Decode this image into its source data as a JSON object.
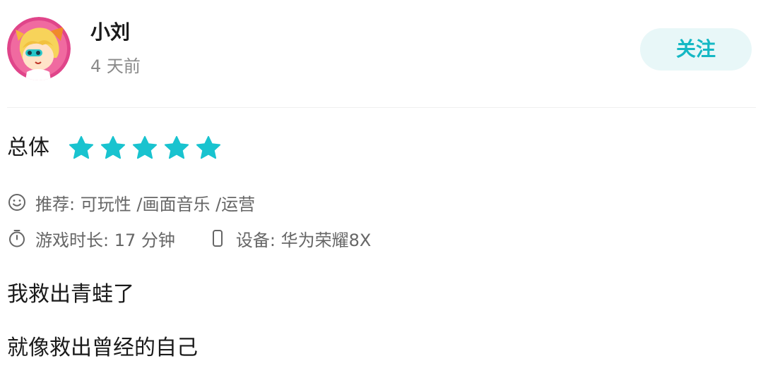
{
  "user": {
    "name": "小刘",
    "time": "4 天前"
  },
  "header": {
    "follow_label": "关注"
  },
  "rating": {
    "label": "总体",
    "value": 5,
    "max": 5,
    "star_color": "#19c3cf"
  },
  "meta": {
    "recommend_prefix": "推荐:",
    "recommend_items": "可玩性 /画面音乐 /运营",
    "playtime_label": "游戏时长:",
    "playtime_value": "17 分钟",
    "device_label": "设备:",
    "device_value": "华为荣耀8X"
  },
  "review": {
    "paragraphs": [
      "我救出青蛙了",
      "就像救出曾经的自己"
    ]
  },
  "icons": {
    "smile": "smile-icon",
    "timer": "timer-icon",
    "phone": "phone-icon"
  },
  "colors": {
    "accent": "#19c3cf",
    "follow_bg": "#e8f7f8",
    "muted_text": "#8a8a8a"
  }
}
